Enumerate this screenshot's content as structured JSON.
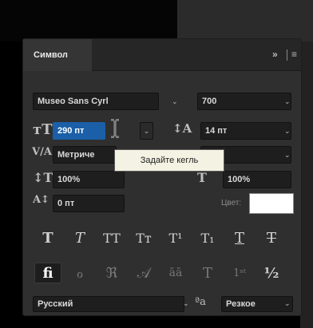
{
  "panel": {
    "tab_label": "Символ",
    "expand_glyph": "»",
    "menu_glyph": "≡"
  },
  "font": {
    "family": "Museo Sans Cyrl",
    "weight": "700"
  },
  "size": {
    "value": "290 пт",
    "leading": "14 пт"
  },
  "kerning": {
    "value": "Метриче"
  },
  "scale": {
    "vertical": "100%",
    "horizontal": "100%"
  },
  "baseline": {
    "value": "0 пт",
    "color_label": "Цвет:"
  },
  "tooltip": {
    "text": "Задайте кегль"
  },
  "style_buttons": [
    {
      "name": "faux-bold-button",
      "glyph": "T"
    },
    {
      "name": "faux-italic-button",
      "glyph": "T"
    },
    {
      "name": "all-caps-button",
      "glyph": "TT"
    },
    {
      "name": "small-caps-button",
      "glyph": "Tᴛ"
    },
    {
      "name": "superscript-button",
      "glyph": "T¹"
    },
    {
      "name": "subscript-button",
      "glyph": "T₁"
    },
    {
      "name": "underline-button",
      "glyph": "T"
    },
    {
      "name": "strikethrough-button",
      "glyph": "T"
    }
  ],
  "opentype_buttons": [
    {
      "name": "ligatures-button",
      "glyph": "fi"
    },
    {
      "name": "discretionary-ligatures-button",
      "glyph": "ℴ"
    },
    {
      "name": "swash-button",
      "glyph": "ℜ"
    },
    {
      "name": "alternates-button",
      "glyph": "𝒜"
    },
    {
      "name": "titling-button",
      "glyph": "āā"
    },
    {
      "name": "ornaments-button",
      "glyph": "T"
    },
    {
      "name": "ordinals-button",
      "glyph": "1ˢᵗ"
    },
    {
      "name": "fractions-button",
      "glyph": "½"
    }
  ],
  "language": {
    "value": "Русский",
    "aa_label": "ªa",
    "antialias": "Резкое"
  }
}
